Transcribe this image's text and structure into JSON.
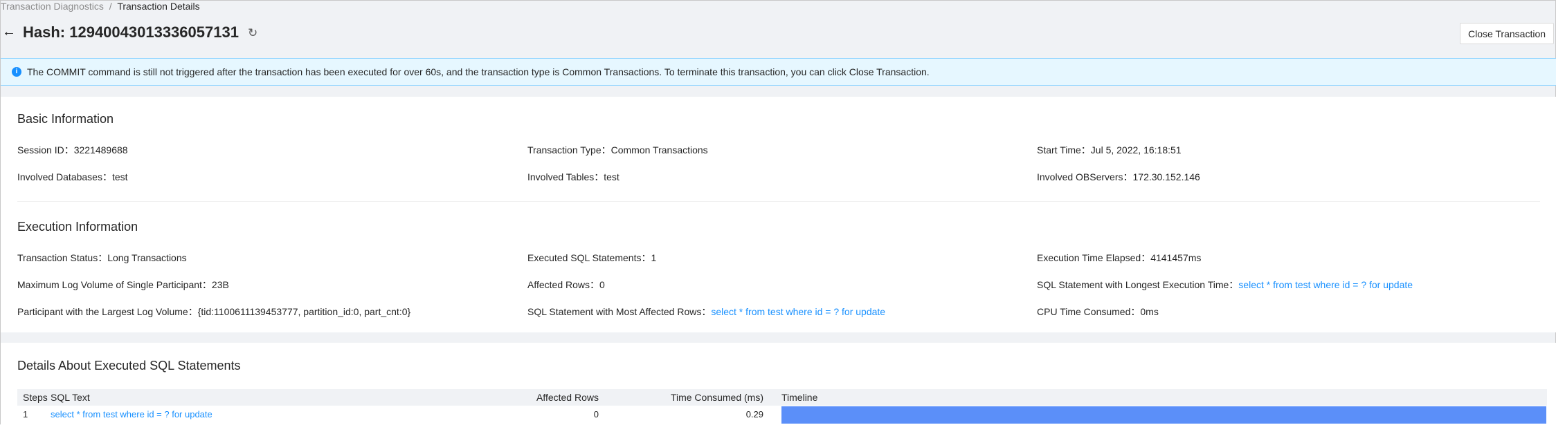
{
  "breadcrumb": {
    "parent": "Transaction Diagnostics",
    "separator": "/",
    "current": "Transaction Details"
  },
  "header": {
    "title": "Hash: 12940043013336057131",
    "close_button": "Close Transaction"
  },
  "alert": {
    "text": "The COMMIT command is still not triggered after the transaction has been executed for over 60s, and the transaction type is Common Transactions. To terminate this transaction, you can click Close Transaction."
  },
  "basic": {
    "title": "Basic Information",
    "fields": [
      {
        "label": "Session ID：",
        "value": "3221489688"
      },
      {
        "label": "Transaction Type：",
        "value": "Common Transactions"
      },
      {
        "label": "Start Time：",
        "value": "Jul 5, 2022, 16:18:51"
      },
      {
        "label": "Involved Databases：",
        "value": "test"
      },
      {
        "label": "Involved Tables：",
        "value": "test"
      },
      {
        "label": "Involved OBServers：",
        "value": "172.30.152.146"
      }
    ]
  },
  "execution": {
    "title": "Execution Information",
    "fields": [
      {
        "label": "Transaction Status：",
        "value": "Long Transactions"
      },
      {
        "label": "Executed SQL Statements：",
        "value": "1"
      },
      {
        "label": "Execution Time Elapsed：",
        "value": "4141457ms"
      },
      {
        "label": "Maximum Log Volume of Single Participant：",
        "value": "23B"
      },
      {
        "label": "Affected Rows：",
        "value": "0"
      },
      {
        "label": "SQL Statement with Longest Execution Time：",
        "value": "select * from test where id = ? for update"
      },
      {
        "label": "Participant with the Largest Log Volume：",
        "value": "{tid:1100611139453777, partition_id:0, part_cnt:0}"
      },
      {
        "label": "SQL Statement with Most Affected Rows：",
        "value": "select * from test where id = ? for update"
      },
      {
        "label": "CPU Time Consumed：",
        "value": "0ms"
      }
    ]
  },
  "sql_details": {
    "title": "Details About Executed SQL Statements",
    "columns": [
      "Steps",
      "SQL Text",
      "Affected Rows",
      "Time Consumed (ms)",
      "Timeline"
    ],
    "rows": [
      {
        "step": "1",
        "sql": "select * from test where id = ? for update",
        "affected": "0",
        "time": "0.29",
        "timeline_fraction": 1.0
      }
    ]
  },
  "colors": {
    "accent": "#1890ff",
    "bar": "#5b8ff9"
  }
}
